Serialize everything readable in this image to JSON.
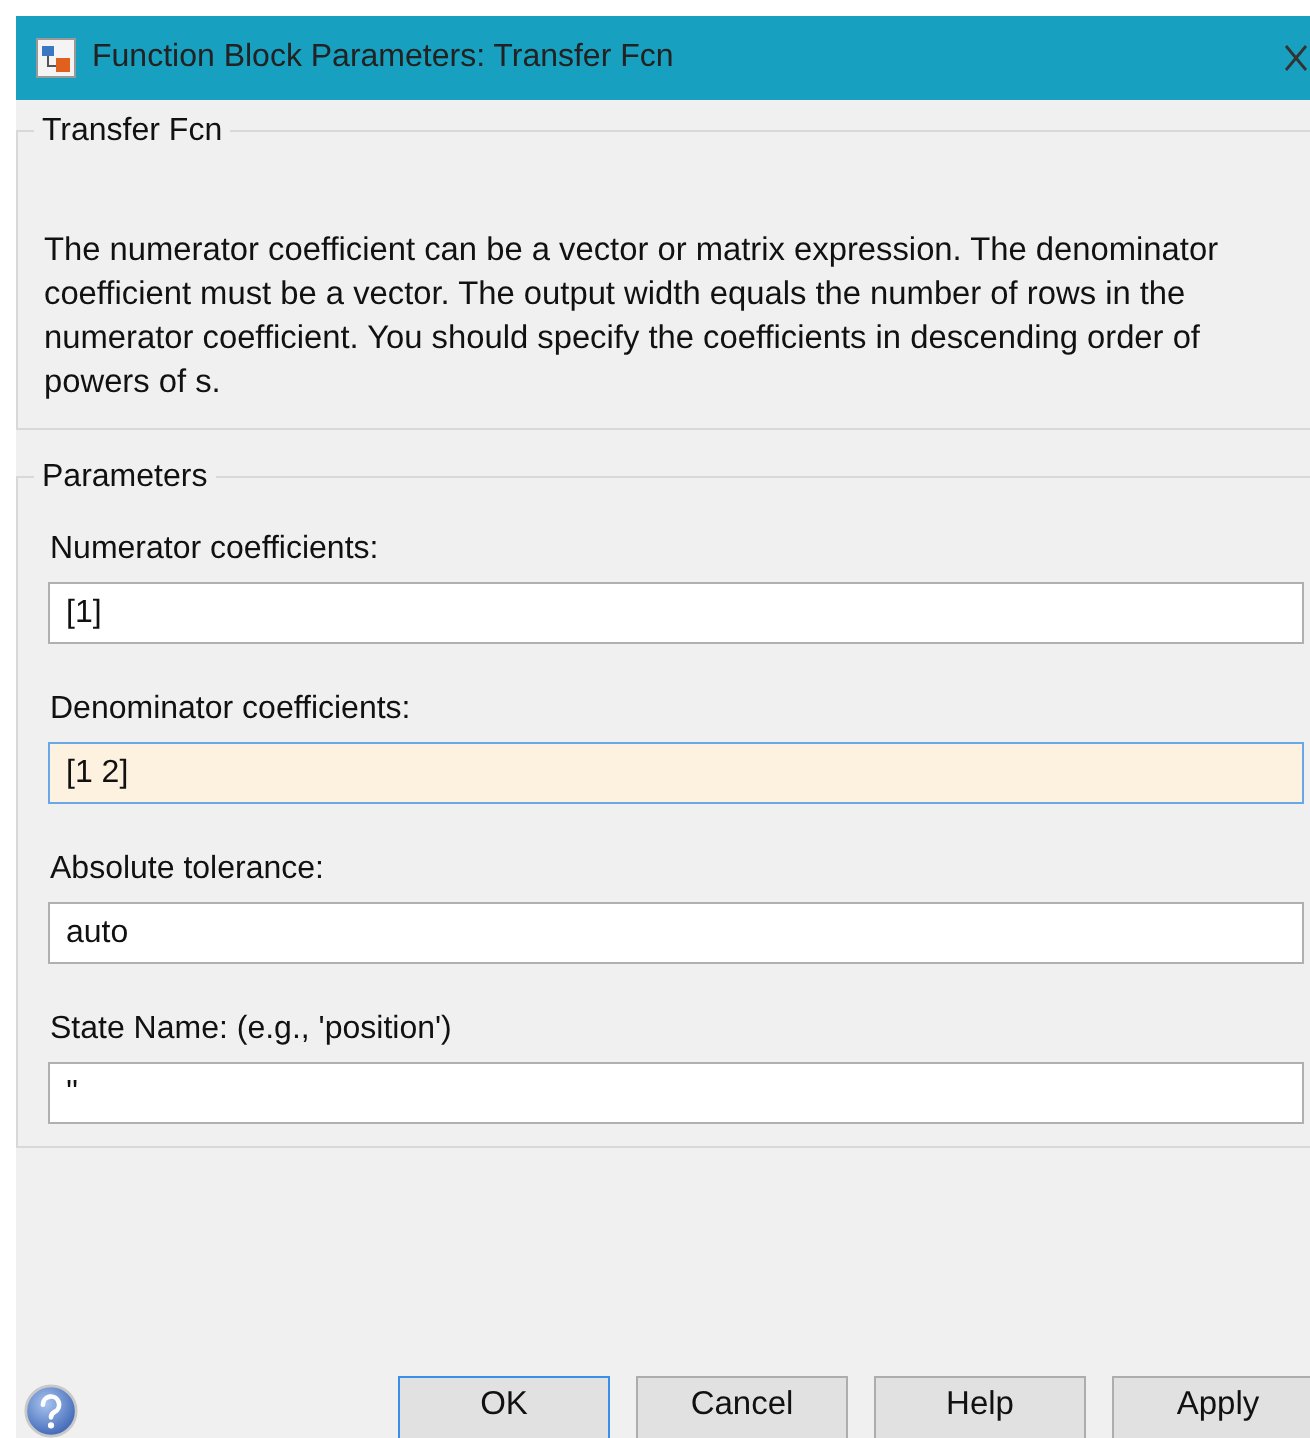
{
  "window": {
    "title": "Function Block Parameters: Transfer Fcn"
  },
  "block": {
    "title": "Transfer Fcn",
    "description": "The numerator coefficient can be a vector or matrix expression. The denominator coefficient must be a vector. The output width equals the number of rows in the numerator coefficient. You should specify the coefficients in descending order of powers of s."
  },
  "parameters": {
    "title": "Parameters",
    "fields": [
      {
        "label": "Numerator coefficients:",
        "value": "[1]",
        "focused": false
      },
      {
        "label": "Denominator coefficients:",
        "value": "[1 2]",
        "focused": true
      },
      {
        "label": "Absolute tolerance:",
        "value": "auto",
        "focused": false
      },
      {
        "label": "State Name: (e.g., 'position')",
        "value": "''",
        "focused": false
      }
    ]
  },
  "buttons": [
    {
      "label": "OK",
      "default": true
    },
    {
      "label": "Cancel",
      "default": false
    },
    {
      "label": "Help",
      "default": false
    },
    {
      "label": "Apply",
      "default": false
    }
  ]
}
